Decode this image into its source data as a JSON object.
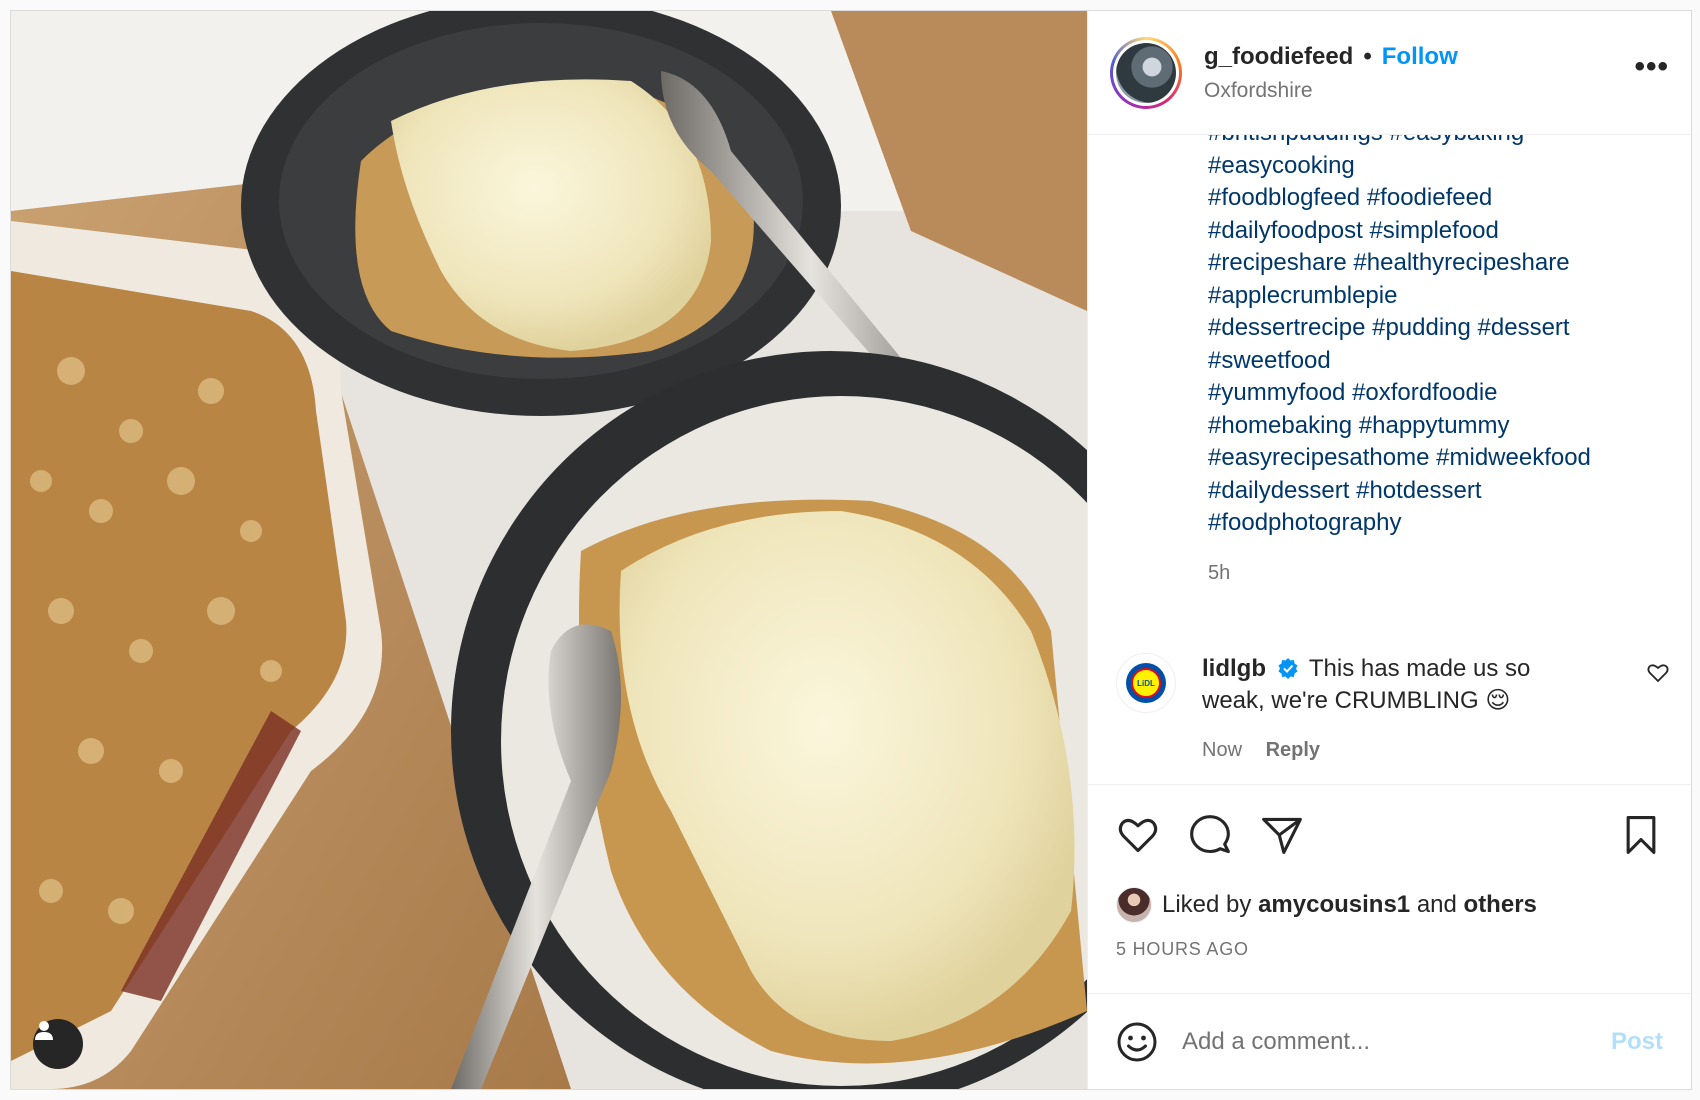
{
  "post": {
    "username": "g_foodiefeed",
    "separator": "•",
    "follow_label": "Follow",
    "location": "Oxfordshire",
    "more_icon": "more-horizontal-icon",
    "more_label": "•••",
    "photo_alt": "Apple crumble with custard"
  },
  "caption": {
    "hashtag_lines": [
      [
        "#britishpuddings",
        "#easybaking"
      ],
      [
        "#easycooking"
      ],
      [
        "#foodblogfeed",
        "#foodiefeed"
      ],
      [
        "#dailyfoodpost",
        "#simplefood"
      ],
      [
        "#recipeshare",
        "#healthyrecipeshare"
      ],
      [
        "#applecrumblepie"
      ],
      [
        "#dessertrecipe",
        "#pudding",
        "#dessert"
      ],
      [
        "#sweetfood"
      ],
      [
        "#yummyfood",
        "#oxfordfoodie"
      ],
      [
        "#homebaking",
        "#happytummy"
      ],
      [
        "#easyrecipesathome",
        "#midweekfood"
      ],
      [
        "#dailydessert",
        "#hotdessert"
      ],
      [
        "#foodphotography"
      ]
    ],
    "time": "5h"
  },
  "comment": {
    "user": "lidlgb",
    "text": "This has made us so weak, we're CRUMBLING 😌",
    "time": "Now",
    "reply_label": "Reply",
    "logo_text": "LiDL"
  },
  "actions": {
    "icons": [
      "heart-icon",
      "comment-icon",
      "share-icon",
      "bookmark-icon"
    ]
  },
  "likes": {
    "prefix": "Liked by",
    "user": "amycousins1",
    "middle": "and",
    "others": "others"
  },
  "timestamp": "5 HOURS AGO",
  "add_comment": {
    "placeholder": "Add a comment...",
    "post_label": "Post"
  },
  "colors": {
    "link": "#0095f6",
    "hashtag": "#00376b",
    "muted": "#737373",
    "post_disabled": "#b2dffc"
  }
}
